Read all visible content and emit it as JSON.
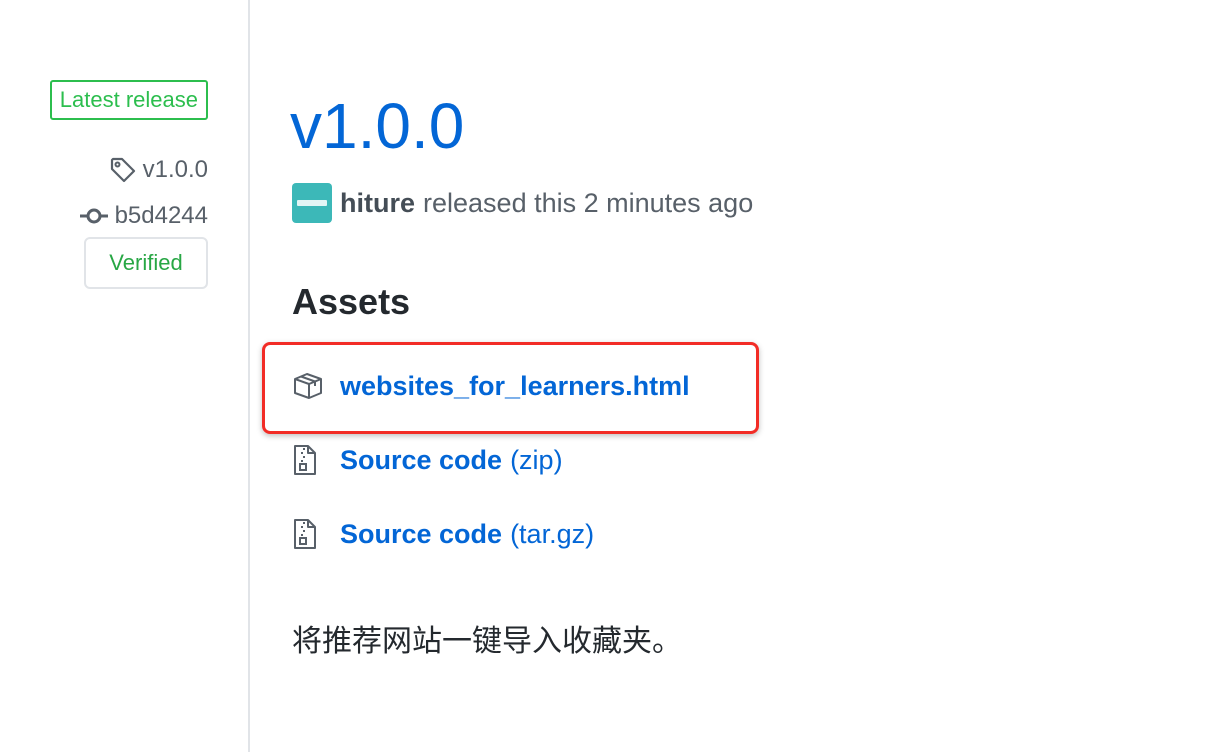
{
  "sidebar": {
    "latest_label": "Latest release",
    "tag": "v1.0.0",
    "commit": "b5d4244",
    "verified_label": "Verified"
  },
  "release": {
    "title": "v1.0.0",
    "author": "hiture",
    "byline": "released this 2 minutes ago"
  },
  "assets": {
    "heading": "Assets",
    "items": [
      {
        "name": "websites_for_learners.html",
        "suffix": "",
        "icon": "package-icon"
      },
      {
        "name": "Source code",
        "suffix": "(zip)",
        "icon": "file-zip-icon"
      },
      {
        "name": "Source code",
        "suffix": "(tar.gz)",
        "icon": "file-zip-icon"
      }
    ]
  },
  "description": "将推荐网站一键导入收藏夹。",
  "colors": {
    "link": "#0366d6",
    "badge_green": "#2cbe4e",
    "verified_green": "#28a745",
    "highlight_red": "#f22c26",
    "avatar": "#3cb8b8"
  }
}
